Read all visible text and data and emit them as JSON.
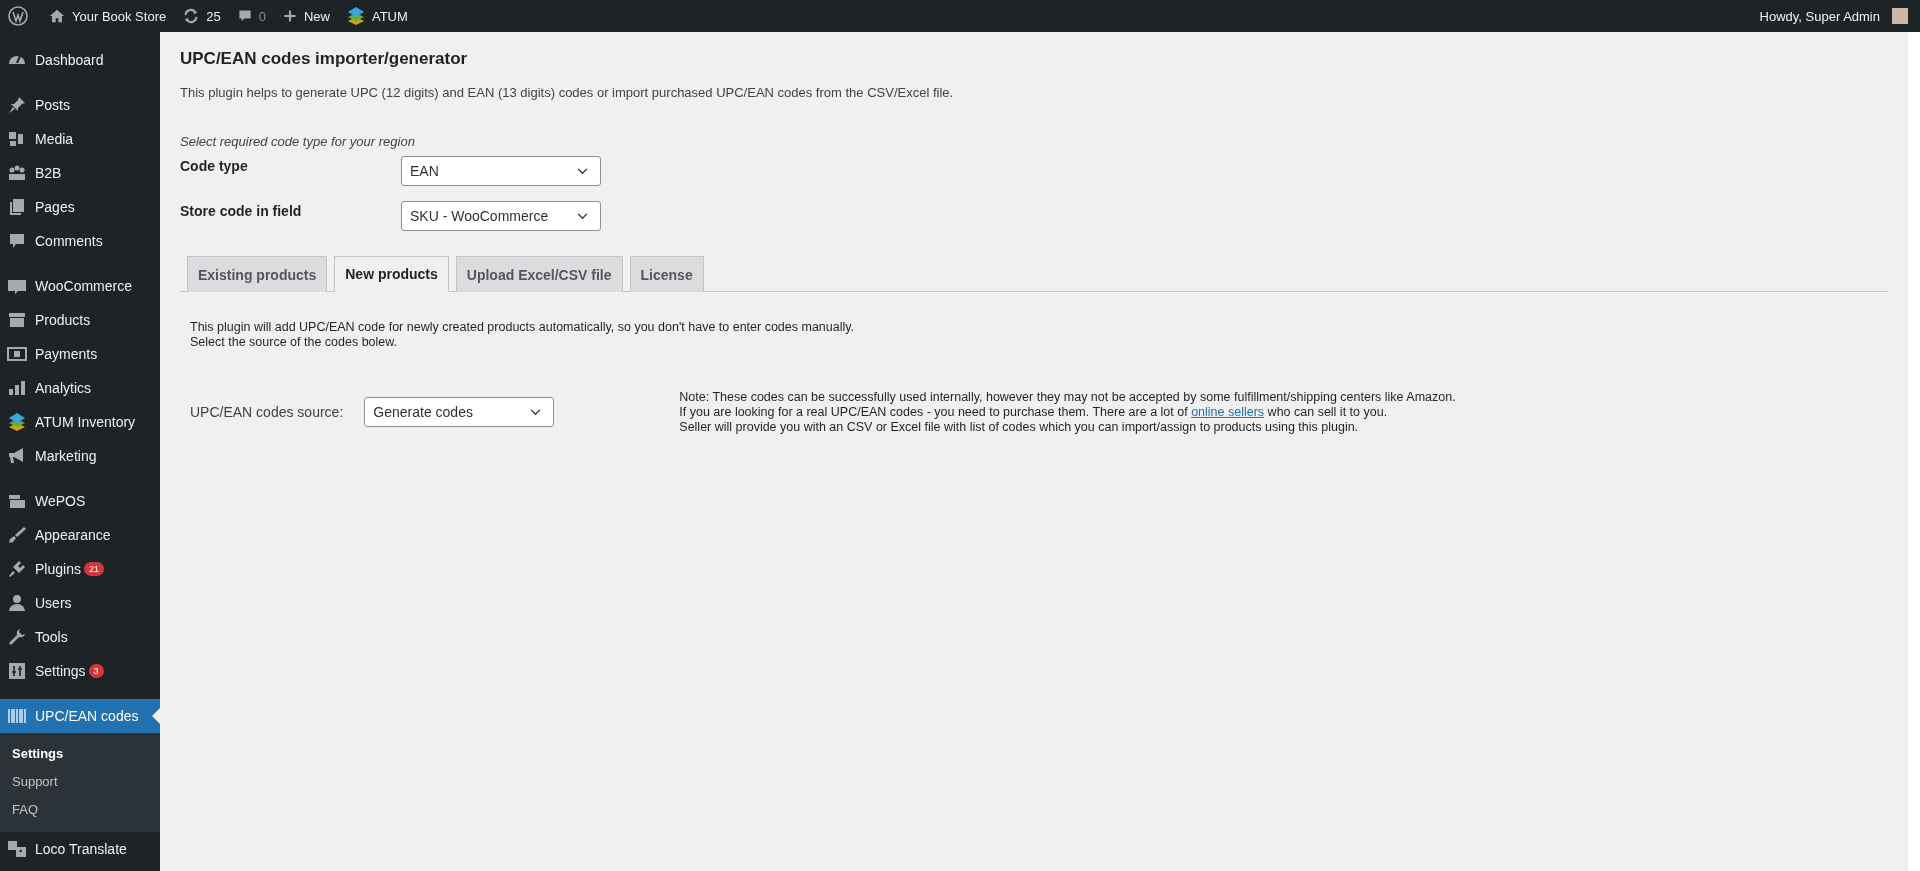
{
  "admin_bar": {
    "site_name": "Your Book Store",
    "updates_count": "25",
    "comments_count": "0",
    "new_label": "New",
    "plugin_label": "ATUM",
    "greeting": "Howdy, Super Admin"
  },
  "sidebar": {
    "groups": [
      {
        "items": [
          {
            "label": "Dashboard",
            "selected": false
          }
        ]
      },
      {
        "items": [
          {
            "label": "Posts",
            "selected": false
          },
          {
            "label": "Media",
            "selected": false
          },
          {
            "label": "B2B",
            "selected": false
          },
          {
            "label": "Pages",
            "selected": false
          },
          {
            "label": "Comments",
            "selected": false
          }
        ]
      },
      {
        "items": [
          {
            "label": "WooCommerce",
            "selected": false
          },
          {
            "label": "Products",
            "selected": false
          },
          {
            "label": "Payments",
            "selected": false
          },
          {
            "label": "Analytics",
            "selected": false
          },
          {
            "label": "ATUM Inventory",
            "selected": false
          },
          {
            "label": "Marketing",
            "selected": false
          }
        ]
      },
      {
        "items": [
          {
            "label": "WePOS",
            "selected": false
          },
          {
            "label": "Appearance",
            "selected": false
          },
          {
            "label": "Plugins",
            "selected": false,
            "badge": "21"
          },
          {
            "label": "Users",
            "selected": false
          },
          {
            "label": "Tools",
            "selected": false
          },
          {
            "label": "Settings",
            "selected": false,
            "badge": "3"
          }
        ]
      },
      {
        "items": [
          {
            "label": "UPC/EAN codes",
            "selected": true,
            "submenu": [
              {
                "label": "Settings",
                "selected": true
              },
              {
                "label": "Support",
                "selected": false
              },
              {
                "label": "FAQ",
                "selected": false
              }
            ]
          },
          {
            "label": "Loco Translate",
            "selected": false
          }
        ]
      }
    ]
  },
  "page": {
    "title": "UPC/EAN codes importer/generator",
    "description": "This plugin helps to generate UPC (12 digits) and EAN (13 digits) codes or import purchased UPC/EAN codes from the CSV/Excel file.",
    "hint": "Select required code type for your region",
    "fields": [
      {
        "label": "Code type",
        "value": "EAN"
      },
      {
        "label": "Store code in field",
        "value": "SKU - WooCommerce"
      }
    ],
    "tabs": [
      {
        "label": "Existing products",
        "selected": false
      },
      {
        "label": "New products",
        "selected": true
      },
      {
        "label": "Upload Excel/CSV file",
        "selected": false
      },
      {
        "label": "License",
        "selected": false
      }
    ],
    "tab_content": {
      "intro_lines": [
        "This plugin will add UPC/EAN code for newly created products automatically, so you don't have to enter codes manually.",
        "Select the source of the codes bolew."
      ],
      "source_label": "UPC/EAN codes source:",
      "source_value": "Generate codes",
      "note_lines": [
        {
          "text": "Note: These codes can be successfully used internally, however they may not be accepted by some fulfillment/shipping centers like Amazon."
        },
        {
          "text": "If you are looking for a real UPC/EAN codes - you need to purchase them. There are a lot of",
          "link": "online sellers",
          "after": "who can sell it to you."
        },
        {
          "text": "Seller will provide you with an CSV or Excel file with list of codes which you can import/assign to products using this plugin."
        }
      ]
    }
  }
}
